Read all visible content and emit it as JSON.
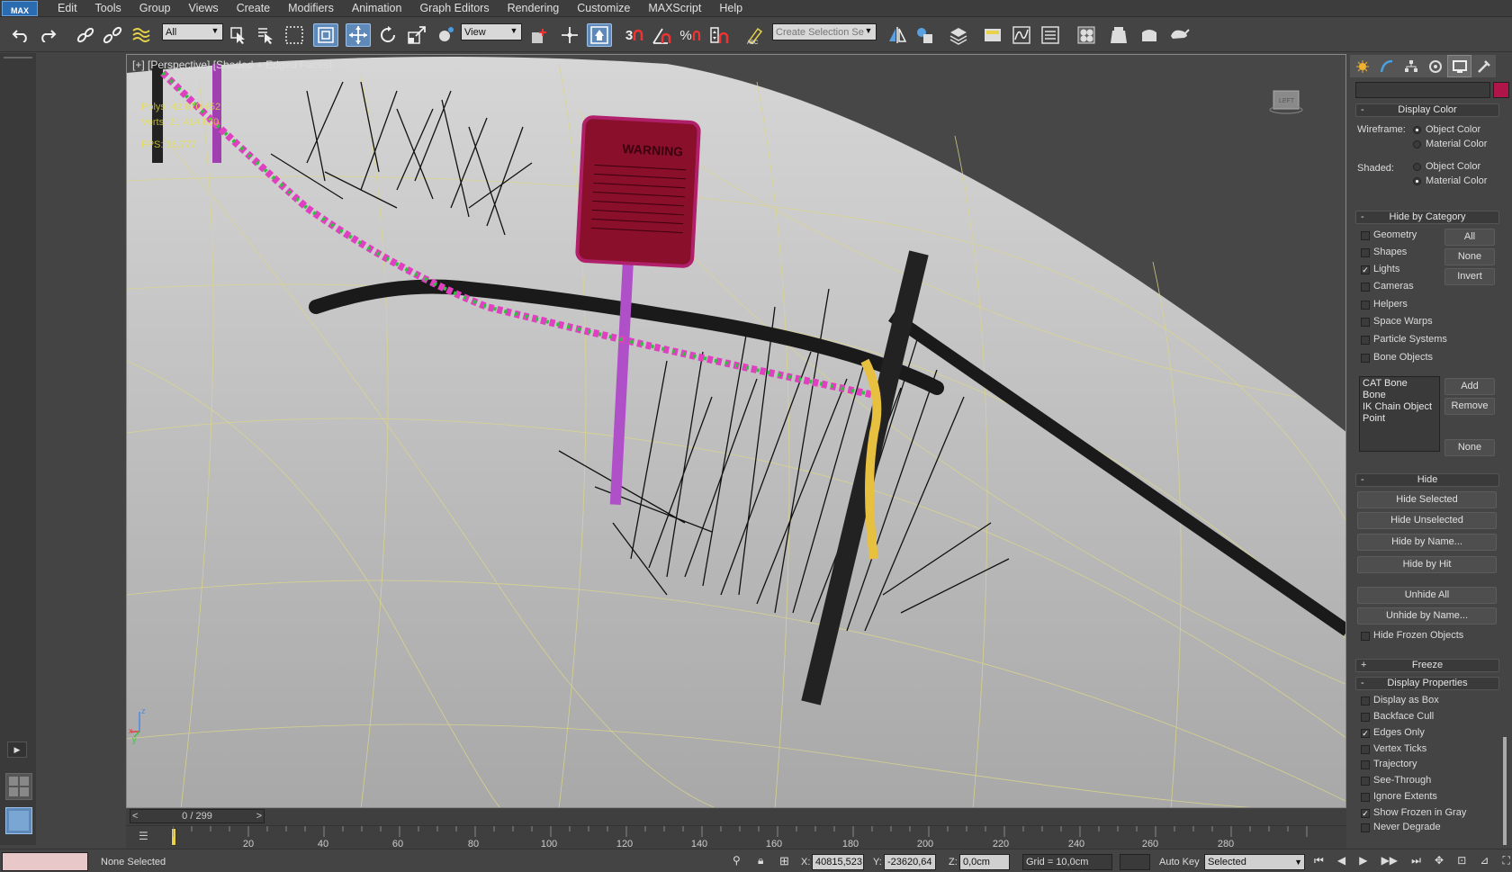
{
  "menu": {
    "logo": "MAX",
    "items": [
      "Edit",
      "Tools",
      "Group",
      "Views",
      "Create",
      "Modifiers",
      "Animation",
      "Graph Editors",
      "Rendering",
      "Customize",
      "MAXScript",
      "Help"
    ]
  },
  "toolbar": {
    "filter_value": "All",
    "coord_value": "View",
    "named_selection_placeholder": "Create Selection Se",
    "snap_label": "3",
    "icons": [
      "undo-icon",
      "redo-icon",
      "link-icon",
      "unlink-icon",
      "bind-spacewarp-icon",
      "select-object-icon",
      "select-by-name-icon",
      "rect-region-icon",
      "window-crossing-icon",
      "move-icon",
      "rotate-icon",
      "scale-icon",
      "place-icon",
      "pivot-icon",
      "manipulate-icon",
      "keyboard-shortcut-icon",
      "snap-icon",
      "angle-snap-icon",
      "percent-snap-icon",
      "spinner-snap-icon",
      "edit-named-sets-icon",
      "mirror-icon",
      "align-icon",
      "layer-manager-icon",
      "ribbon-icon",
      "curve-editor-icon",
      "schematic-view-icon",
      "material-editor-icon",
      "render-setup-icon",
      "rendered-frame-icon",
      "render-icon"
    ]
  },
  "viewport": {
    "label": "[+] [Perspective] [Shaded + Edged Faces]",
    "stats": [
      "Polys: 42 870 452",
      "Verts: 21 414 830",
      "FPS: 36,777"
    ],
    "sign_text": "WARNING",
    "axis": {
      "x": "x",
      "y": "y",
      "z": "z"
    },
    "viewcube_text": "LEFT"
  },
  "command_panel": {
    "display_color": {
      "title": "Display Color",
      "wireframe_label": "Wireframe:",
      "shaded_label": "Shaded:",
      "options": [
        "Object Color",
        "Material Color"
      ],
      "wireframe_selected": "Object Color",
      "shaded_selected": "Material Color"
    },
    "hide_by_category": {
      "title": "Hide by Category",
      "items": [
        {
          "label": "Geometry",
          "checked": false
        },
        {
          "label": "Shapes",
          "checked": false
        },
        {
          "label": "Lights",
          "checked": true
        },
        {
          "label": "Cameras",
          "checked": false
        },
        {
          "label": "Helpers",
          "checked": false
        },
        {
          "label": "Space Warps",
          "checked": false
        },
        {
          "label": "Particle Systems",
          "checked": false
        },
        {
          "label": "Bone Objects",
          "checked": false
        }
      ],
      "buttons": [
        "All",
        "None",
        "Invert"
      ],
      "list": [
        "CAT Bone",
        "Bone",
        "IK Chain Object",
        "Point"
      ],
      "list_buttons": [
        "Add",
        "Remove",
        "None"
      ]
    },
    "hide": {
      "title": "Hide",
      "buttons": [
        "Hide Selected",
        "Hide Unselected",
        "Hide by Name...",
        "Hide by Hit",
        "Unhide All",
        "Unhide by Name..."
      ],
      "frozen_label": "Hide Frozen Objects",
      "frozen_checked": false
    },
    "freeze": {
      "title": "Freeze"
    },
    "display_properties": {
      "title": "Display Properties",
      "items": [
        {
          "label": "Display as Box",
          "checked": false
        },
        {
          "label": "Backface Cull",
          "checked": false
        },
        {
          "label": "Edges Only",
          "checked": true
        },
        {
          "label": "Vertex Ticks",
          "checked": false
        },
        {
          "label": "Trajectory",
          "checked": false
        },
        {
          "label": "See-Through",
          "checked": false
        },
        {
          "label": "Ignore Extents",
          "checked": false
        },
        {
          "label": "Show Frozen in Gray",
          "checked": true
        },
        {
          "label": "Never Degrade",
          "checked": false
        }
      ]
    },
    "object_color": "#b0154a"
  },
  "timeline": {
    "frame_display": "0 / 299",
    "prev": "<",
    "next": ">",
    "ticks": [
      "20",
      "40",
      "60",
      "80",
      "100",
      "120",
      "140",
      "160",
      "180",
      "200",
      "220",
      "240",
      "260",
      "280"
    ]
  },
  "status": {
    "selection": "None Selected",
    "x_label": "X:",
    "x_value": "40815,523",
    "y_label": "Y:",
    "y_value": "-23620,64",
    "z_label": "Z:",
    "z_value": "0,0cm",
    "grid": "Grid = 10,0cm",
    "auto_key": "Auto Key",
    "key_mode": "Selected"
  }
}
